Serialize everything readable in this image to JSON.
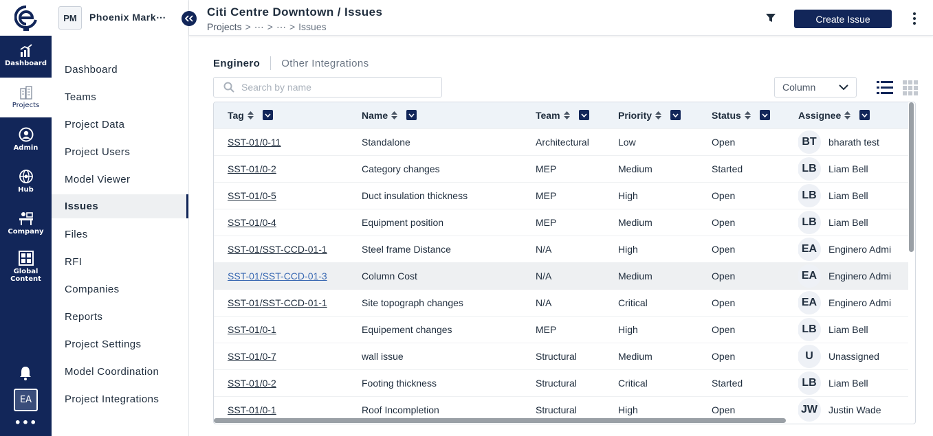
{
  "rail": {
    "items": [
      {
        "label": "Dashboard",
        "icon": "chart-icon"
      },
      {
        "label": "Projects",
        "icon": "buildings-icon"
      },
      {
        "label": "Admin",
        "icon": "user-circle-icon"
      },
      {
        "label": "Hub",
        "icon": "globe-icon"
      },
      {
        "label": "Company",
        "icon": "company-icon"
      },
      {
        "label": "Global Content",
        "icon": "global-content-icon"
      }
    ],
    "avatar": "EA",
    "more": "•••"
  },
  "project": {
    "badge": "PM",
    "name": "Phoenix Mark⋯"
  },
  "nav": {
    "items": [
      "Dashboard",
      "Teams",
      "Project Data",
      "Project Users",
      "Model Viewer",
      "Issues",
      "Files",
      "RFI",
      "Companies",
      "Reports",
      "Project Settings",
      "Model Coordination",
      "Project Integrations"
    ]
  },
  "header": {
    "title": "Citi Centre Downtown / Issues",
    "breadcrumb": [
      "Projects",
      "⋯",
      "⋯",
      "Issues"
    ],
    "create_label": "Create Issue"
  },
  "tabs": [
    "Enginero",
    "Other Integrations"
  ],
  "search": {
    "placeholder": "Search by name"
  },
  "view_select": "Column",
  "table": {
    "columns": [
      "Tag",
      "Name",
      "Team",
      "Priority",
      "Status",
      "Assignee"
    ],
    "rows": [
      {
        "tag": "SST-01/0-11",
        "name": "Standalone",
        "team": "Architectural",
        "priority": "Low",
        "status": "Open",
        "initials": "BT",
        "assignee": "bharath test"
      },
      {
        "tag": "SST-01/0-2",
        "name": "Category changes",
        "team": "MEP",
        "priority": "Medium",
        "status": "Started",
        "initials": "LB",
        "assignee": "Liam Bell"
      },
      {
        "tag": "SST-01/0-5",
        "name": "Duct insulation thickness",
        "team": "MEP",
        "priority": "High",
        "status": "Open",
        "initials": "LB",
        "assignee": "Liam Bell"
      },
      {
        "tag": "SST-01/0-4",
        "name": "Equipment position",
        "team": "MEP",
        "priority": "Medium",
        "status": "Open",
        "initials": "LB",
        "assignee": "Liam Bell"
      },
      {
        "tag": "SST-01/SST-CCD-01-1",
        "name": "Steel frame Distance",
        "team": "N/A",
        "priority": "High",
        "status": "Open",
        "initials": "EA",
        "assignee": "Enginero Admi"
      },
      {
        "tag": "SST-01/SST-CCD-01-3",
        "name": "Column Cost",
        "team": "N/A",
        "priority": "Medium",
        "status": "Open",
        "initials": "EA",
        "assignee": "Enginero Admi"
      },
      {
        "tag": "SST-01/SST-CCD-01-1",
        "name": "Site topograph changes",
        "team": "N/A",
        "priority": "Critical",
        "status": "Open",
        "initials": "EA",
        "assignee": "Enginero Admi"
      },
      {
        "tag": "SST-01/0-1",
        "name": "Equipement changes",
        "team": "MEP",
        "priority": "High",
        "status": "Open",
        "initials": "LB",
        "assignee": "Liam Bell"
      },
      {
        "tag": "SST-01/0-7",
        "name": "wall issue",
        "team": "Structural",
        "priority": "Medium",
        "status": "Open",
        "initials": "U",
        "assignee": "Unassigned"
      },
      {
        "tag": "SST-01/0-2",
        "name": "Footing thickness",
        "team": "Structural",
        "priority": "Critical",
        "status": "Started",
        "initials": "LB",
        "assignee": "Liam Bell"
      },
      {
        "tag": "SST-01/0-1",
        "name": "Roof Incompletion",
        "team": "Structural",
        "priority": "High",
        "status": "Open",
        "initials": "JW",
        "assignee": "Justin Wade"
      }
    ]
  },
  "colors": {
    "brand": "#122659",
    "link_hover": "#3b6ab3"
  }
}
